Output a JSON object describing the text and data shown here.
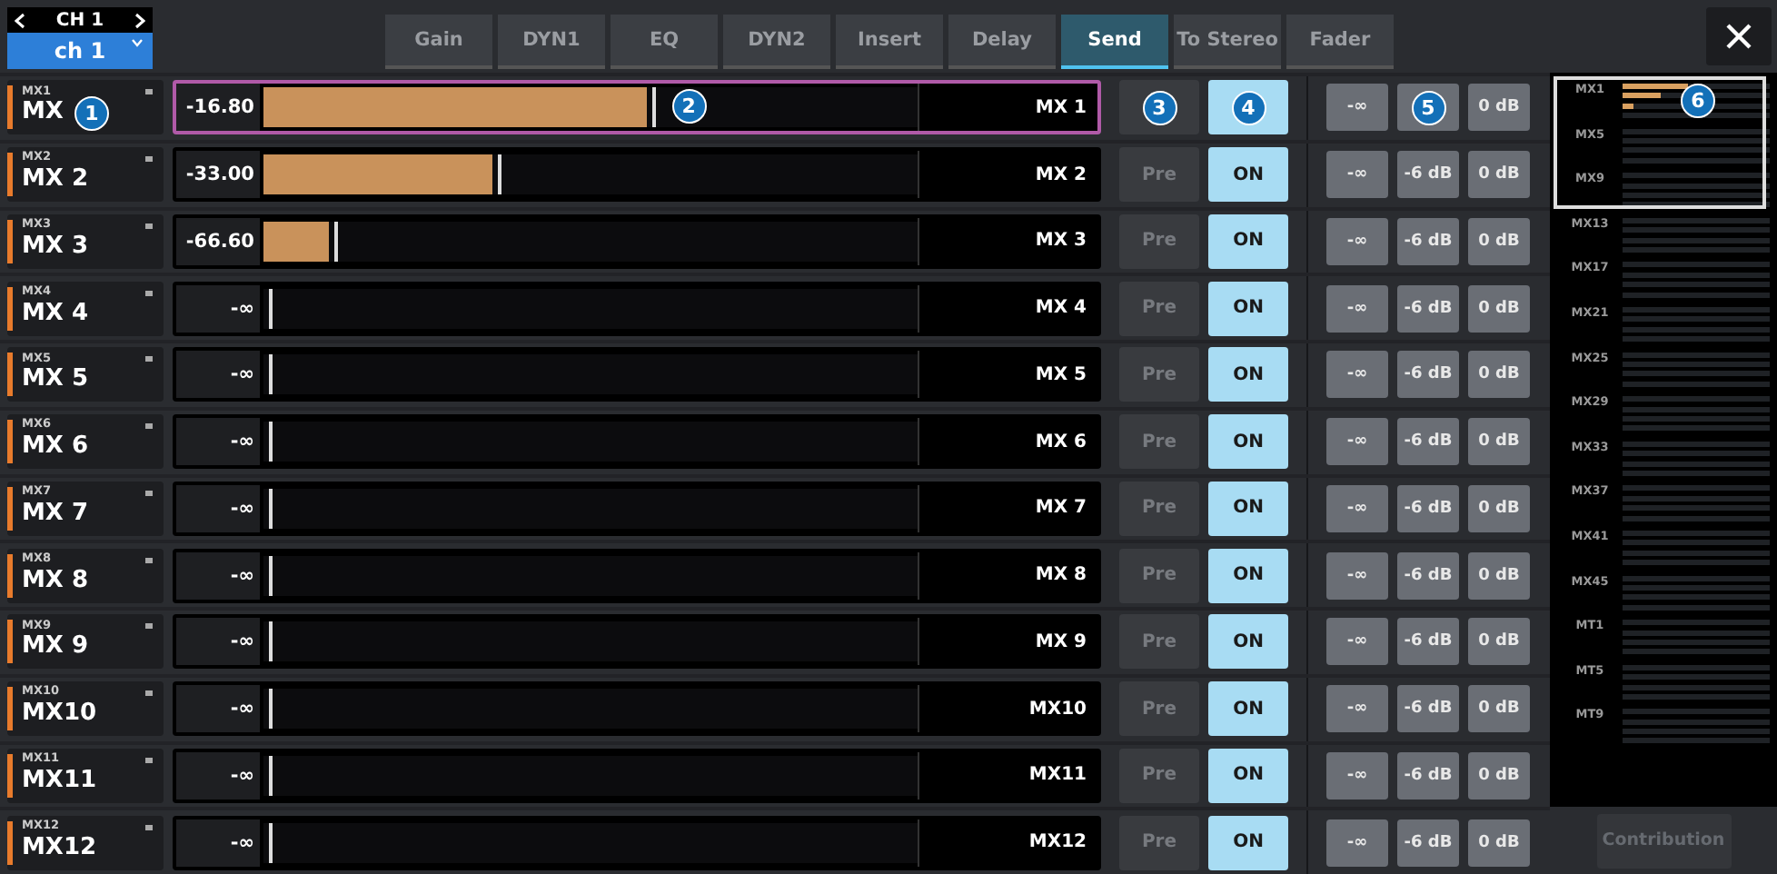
{
  "channel_selector": {
    "channel": "CH 1",
    "name": "ch 1"
  },
  "tabs": [
    {
      "label": "Gain",
      "selected": false
    },
    {
      "label": "DYN1",
      "selected": false
    },
    {
      "label": "EQ",
      "selected": false
    },
    {
      "label": "DYN2",
      "selected": false
    },
    {
      "label": "Insert",
      "selected": false
    },
    {
      "label": "Delay",
      "selected": false
    },
    {
      "label": "Send",
      "selected": true
    },
    {
      "label": "To Stereo",
      "selected": false
    },
    {
      "label": "Fader",
      "selected": false
    }
  ],
  "rows": [
    {
      "short": "MX1",
      "name": "MX",
      "name_callout": "1",
      "value": "-16.80",
      "level": 0.585,
      "fader_callout": "2",
      "dest": "MX 1",
      "selected": true,
      "pre": {
        "on": false,
        "callout": "3"
      },
      "send": {
        "on": true,
        "callout": "4"
      },
      "db_buttons": [
        {
          "label": "-∞"
        },
        {
          "callout": "5"
        },
        {
          "label": "0 dB"
        }
      ]
    },
    {
      "short": "MX2",
      "name": "MX 2",
      "value": "-33.00",
      "level": 0.35,
      "dest": "MX 2",
      "selected": false,
      "pre": {
        "on": false,
        "label": "Pre"
      },
      "send": {
        "on": true,
        "label": "ON"
      },
      "db_buttons": [
        {
          "label": "-∞"
        },
        {
          "label": "-6 dB"
        },
        {
          "label": "0 dB"
        }
      ]
    },
    {
      "short": "MX3",
      "name": "MX 3",
      "value": "-66.60",
      "level": 0.1,
      "dest": "MX 3",
      "selected": false,
      "pre": {
        "on": false,
        "label": "Pre"
      },
      "send": {
        "on": true,
        "label": "ON"
      },
      "db_buttons": [
        {
          "label": "-∞"
        },
        {
          "label": "-6 dB"
        },
        {
          "label": "0 dB"
        }
      ]
    },
    {
      "short": "MX4",
      "name": "MX 4",
      "value": "-∞",
      "dest": "MX 4",
      "selected": false,
      "pre": {
        "on": false,
        "label": "Pre"
      },
      "send": {
        "on": true,
        "label": "ON"
      },
      "db_buttons": [
        {
          "label": "-∞"
        },
        {
          "label": "-6 dB"
        },
        {
          "label": "0 dB"
        }
      ]
    },
    {
      "short": "MX5",
      "name": "MX 5",
      "value": "-∞",
      "dest": "MX 5",
      "selected": false,
      "pre": {
        "on": false,
        "label": "Pre"
      },
      "send": {
        "on": true,
        "label": "ON"
      },
      "db_buttons": [
        {
          "label": "-∞"
        },
        {
          "label": "-6 dB"
        },
        {
          "label": "0 dB"
        }
      ]
    },
    {
      "short": "MX6",
      "name": "MX 6",
      "value": "-∞",
      "dest": "MX 6",
      "selected": false,
      "pre": {
        "on": false,
        "label": "Pre"
      },
      "send": {
        "on": true,
        "label": "ON"
      },
      "db_buttons": [
        {
          "label": "-∞"
        },
        {
          "label": "-6 dB"
        },
        {
          "label": "0 dB"
        }
      ]
    },
    {
      "short": "MX7",
      "name": "MX 7",
      "value": "-∞",
      "dest": "MX 7",
      "selected": false,
      "pre": {
        "on": false,
        "label": "Pre"
      },
      "send": {
        "on": true,
        "label": "ON"
      },
      "db_buttons": [
        {
          "label": "-∞"
        },
        {
          "label": "-6 dB"
        },
        {
          "label": "0 dB"
        }
      ]
    },
    {
      "short": "MX8",
      "name": "MX 8",
      "value": "-∞",
      "dest": "MX 8",
      "selected": false,
      "pre": {
        "on": false,
        "label": "Pre"
      },
      "send": {
        "on": true,
        "label": "ON"
      },
      "db_buttons": [
        {
          "label": "-∞"
        },
        {
          "label": "-6 dB"
        },
        {
          "label": "0 dB"
        }
      ]
    },
    {
      "short": "MX9",
      "name": "MX 9",
      "value": "-∞",
      "dest": "MX 9",
      "selected": false,
      "pre": {
        "on": false,
        "label": "Pre"
      },
      "send": {
        "on": true,
        "label": "ON"
      },
      "db_buttons": [
        {
          "label": "-∞"
        },
        {
          "label": "-6 dB"
        },
        {
          "label": "0 dB"
        }
      ]
    },
    {
      "short": "MX10",
      "name": "MX10",
      "value": "-∞",
      "dest": "MX10",
      "selected": false,
      "pre": {
        "on": false,
        "label": "Pre"
      },
      "send": {
        "on": true,
        "label": "ON"
      },
      "db_buttons": [
        {
          "label": "-∞"
        },
        {
          "label": "-6 dB"
        },
        {
          "label": "0 dB"
        }
      ]
    },
    {
      "short": "MX11",
      "name": "MX11",
      "value": "-∞",
      "dest": "MX11",
      "selected": false,
      "pre": {
        "on": false,
        "label": "Pre"
      },
      "send": {
        "on": true,
        "label": "ON"
      },
      "db_buttons": [
        {
          "label": "-∞"
        },
        {
          "label": "-6 dB"
        },
        {
          "label": "0 dB"
        }
      ]
    },
    {
      "short": "MX12",
      "name": "MX12",
      "value": "-∞",
      "dest": "MX12",
      "selected": false,
      "pre": {
        "on": false,
        "label": "Pre"
      },
      "send": {
        "on": true,
        "label": "ON"
      },
      "db_buttons": [
        {
          "label": "-∞"
        },
        {
          "label": "-6 dB"
        },
        {
          "label": "0 dB"
        }
      ]
    }
  ],
  "overview": {
    "callout": "6",
    "labels": [
      "MX1",
      "MX5",
      "MX9",
      "MX13",
      "MX17",
      "MX21",
      "MX25",
      "MX29",
      "MX33",
      "MX37",
      "MX41",
      "MX45",
      "MT1",
      "MT5",
      "MT9"
    ]
  },
  "contribution_button": "Contribution"
}
